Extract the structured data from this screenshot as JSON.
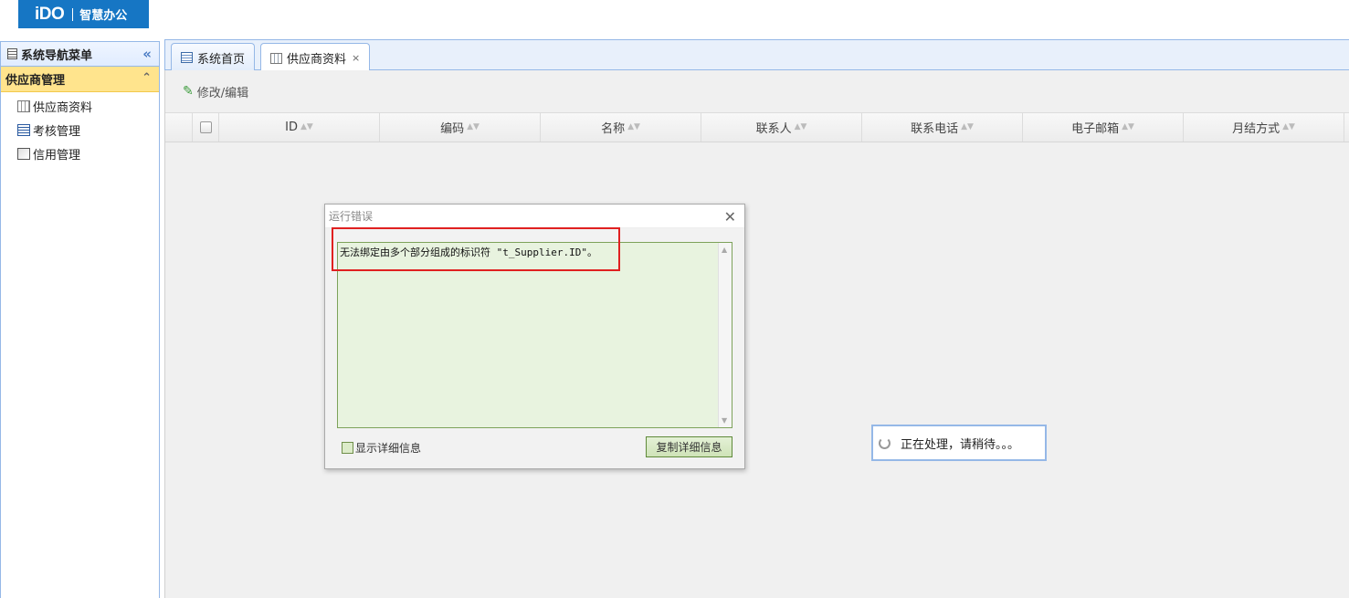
{
  "header": {
    "logo_brand": "iDO",
    "logo_sub": "智慧办公"
  },
  "sidebar": {
    "title": "系统导航菜单",
    "group": "供应商管理",
    "items": [
      {
        "label": "供应商资料",
        "icon": "table-icon"
      },
      {
        "label": "考核管理",
        "icon": "form-icon"
      },
      {
        "label": "信用管理",
        "icon": "document-icon"
      }
    ]
  },
  "tabs": [
    {
      "label": "系统首页",
      "icon": "list-icon"
    },
    {
      "label": "供应商资料",
      "icon": "table-icon",
      "close": "×"
    }
  ],
  "toolbar": {
    "edit_label": "修改/编辑"
  },
  "grid": {
    "columns": [
      "ID",
      "编码",
      "名称",
      "联系人",
      "联系电话",
      "电子邮箱",
      "月结方式"
    ]
  },
  "dialog": {
    "title": "运行错误",
    "message": "无法绑定由多个部分组成的标识符 \"t_Supplier.ID\"。",
    "show_details": "显示详细信息",
    "copy_details": "复制详细信息"
  },
  "loading": {
    "text": "正在处理，请稍待。。。"
  },
  "colors": {
    "accent": "#1676c4",
    "group_bg": "#ffe48d",
    "border": "#95b8e7",
    "highlight": "#e02020"
  }
}
